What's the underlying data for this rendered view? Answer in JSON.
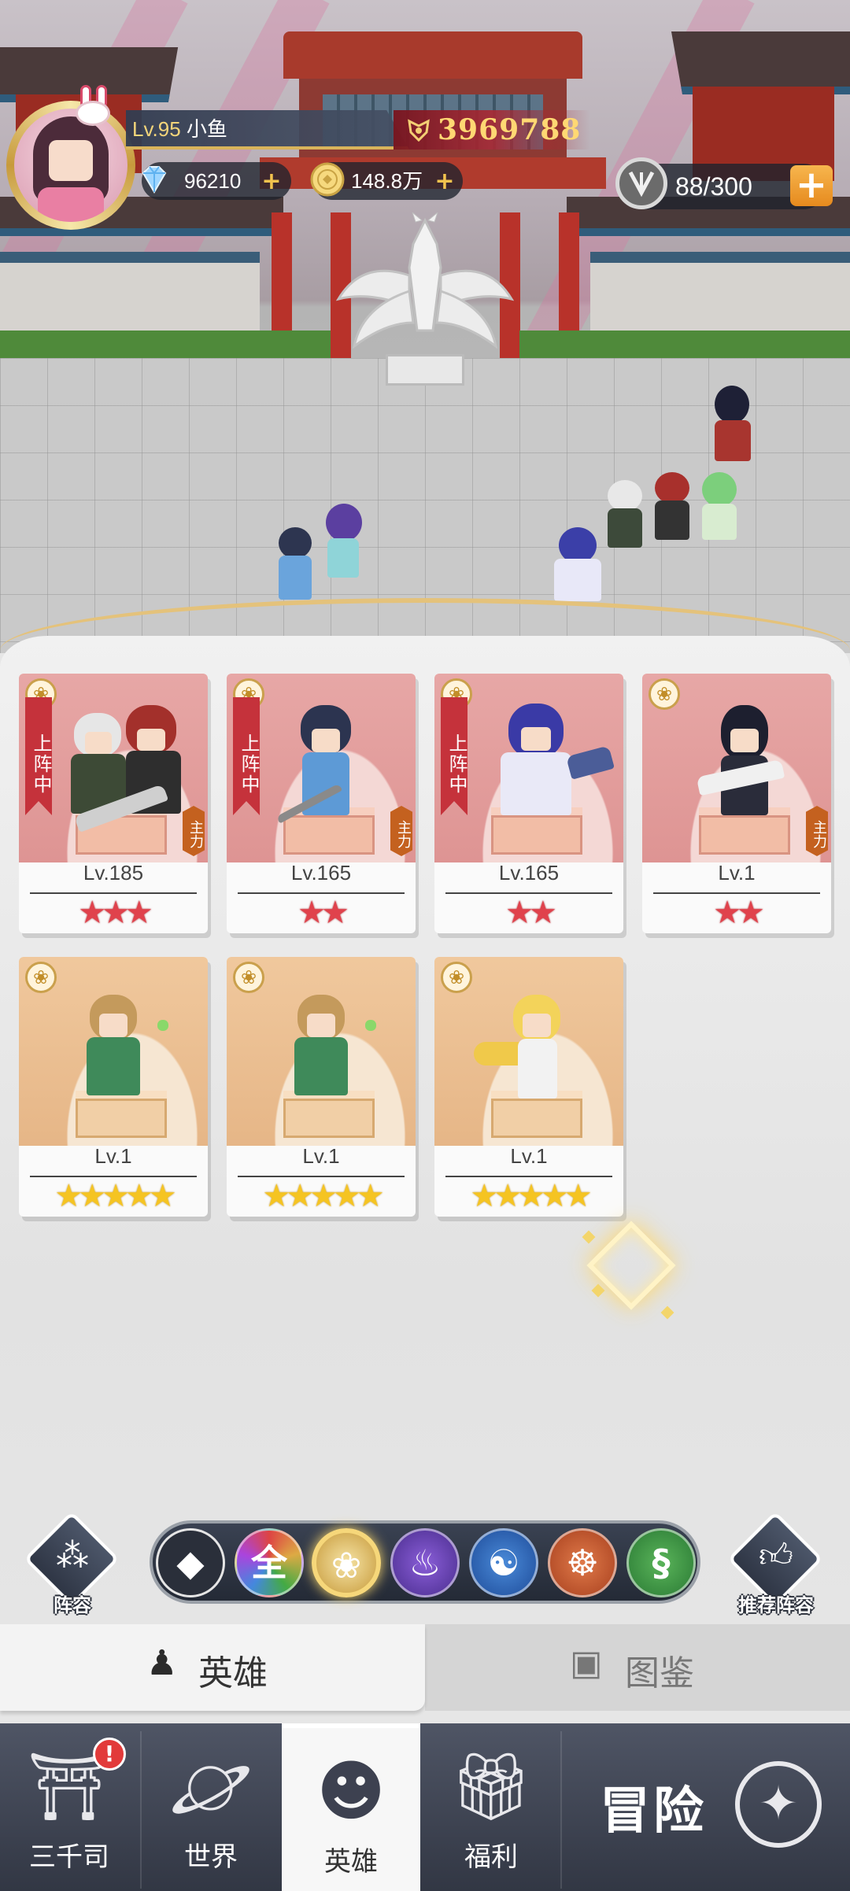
{
  "player": {
    "level": "Lv.95",
    "name": "小鱼",
    "power": "3969788",
    "diamonds": "96210",
    "gold": "148.8万",
    "energy": "88/300"
  },
  "heroes": [
    {
      "level": "Lv.185",
      "stars": "★★★",
      "deployed": "上阵中",
      "main": "主力"
    },
    {
      "level": "Lv.165",
      "stars": "★★",
      "deployed": "上阵中",
      "main": "主力"
    },
    {
      "level": "Lv.165",
      "stars": "★★",
      "deployed": "上阵中",
      "main": ""
    },
    {
      "level": "Lv.1",
      "stars": "★★",
      "deployed": "",
      "main": "主力"
    },
    {
      "level": "Lv.1",
      "stars": "★★★★★",
      "deployed": "",
      "main": ""
    },
    {
      "level": "Lv.1",
      "stars": "★★★★★",
      "deployed": "",
      "main": ""
    },
    {
      "level": "Lv.1",
      "stars": "★★★★★",
      "deployed": "",
      "main": ""
    }
  ],
  "filters": {
    "lineup_label": "阵容",
    "recommend_label": "推荐阵容",
    "all_label": "全",
    "icons": [
      "diamond-pattern-icon",
      "all-icon",
      "lotus-icon",
      "fire-icon",
      "swirl-icon",
      "meditation-icon",
      "dna-icon"
    ],
    "selected": "lotus-icon"
  },
  "tabs": {
    "heroes": "英雄",
    "codex": "图鉴"
  },
  "nav": {
    "items": [
      "三千司",
      "世界",
      "英雄",
      "福利"
    ],
    "adventure": "冒险",
    "badge": "!",
    "active": "英雄"
  },
  "colors": {
    "rare_card": "#de9493",
    "common_card": "#e6b687",
    "deploy_ribbon": "#c5323b",
    "power_text": "#ffd873",
    "energy_plus": "#f0a032"
  }
}
